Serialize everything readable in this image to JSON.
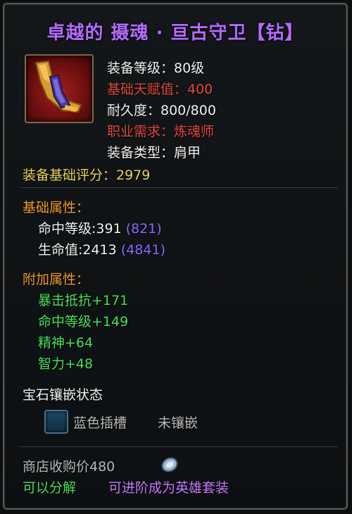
{
  "item": {
    "title": "卓越的 摄魂 · 亘古守卫【钻】",
    "icon_name": "shoulder-armor-icon",
    "level": "装备等级：80级",
    "base_talent": "基础天赋值：400",
    "durability": "耐久度：800/800",
    "class_req": "职业需求：炼魂师",
    "type": "装备类型：肩甲"
  },
  "score": "装备基础评分：2979",
  "base_attrs": {
    "header": "基础属性：",
    "items": [
      {
        "label": "命中等级:391",
        "extra": "(821)"
      },
      {
        "label": "生命值:2413",
        "extra": "(4841)"
      }
    ]
  },
  "extra_attrs": {
    "header": "附加属性：",
    "items": [
      "暴击抵抗+171",
      "命中等级+149",
      "精神+64",
      "智力+48"
    ]
  },
  "gems": {
    "header": "宝石镶嵌状态",
    "slot_icon": "blue-socket-icon",
    "slot_label": "蓝色插槽",
    "slot_status": "未镶嵌"
  },
  "footer": {
    "shop_price": "商店收购价480",
    "coin_icon": "silver-coin-icon",
    "decompose": "可以分解",
    "upgrade": "可进阶成为英雄套装"
  },
  "colors": {
    "title": "#b46bff",
    "red": "#e0483d",
    "gold": "#e8d55a",
    "orange": "#f09a2c",
    "green": "#48e05c",
    "purple": "#8a6bff"
  }
}
